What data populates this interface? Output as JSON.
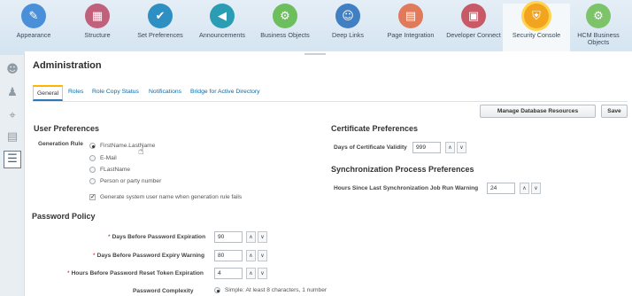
{
  "springboard": {
    "items": [
      {
        "label": "Appearance",
        "icon": "paintbrush-icon",
        "glyph": "✎",
        "color": "#4a90d9"
      },
      {
        "label": "Structure",
        "icon": "grid-icon",
        "glyph": "▦",
        "color": "#c0607a"
      },
      {
        "label": "Set Preferences",
        "icon": "user-check-icon",
        "glyph": "✔",
        "color": "#2e8fc2"
      },
      {
        "label": "Announcements",
        "icon": "megaphone-icon",
        "glyph": "◀",
        "color": "#2a9db5"
      },
      {
        "label": "Business Objects",
        "icon": "gears-icon",
        "glyph": "⚙",
        "color": "#6cbf5c"
      },
      {
        "label": "Deep Links",
        "icon": "people-icon",
        "glyph": "☺",
        "color": "#3f7fc2"
      },
      {
        "label": "Page Integration",
        "icon": "document-icon",
        "glyph": "▤",
        "color": "#e07a5a"
      },
      {
        "label": "Developer Connect",
        "icon": "monitor-icon",
        "glyph": "▣",
        "color": "#c85a68"
      },
      {
        "label": "Security Console",
        "icon": "shield-icon",
        "glyph": "⛨",
        "color": "#f2a41e"
      },
      {
        "label": "HCM Business Objects",
        "label_line1": "HCM Business",
        "label_line2": "Objects",
        "icon": "gears-icon",
        "glyph": "⚙",
        "color": "#7cc36a"
      }
    ]
  },
  "rail": {
    "items": [
      {
        "name": "people-group-icon",
        "glyph": "☻"
      },
      {
        "name": "user-icon",
        "glyph": "♟"
      },
      {
        "name": "user-search-icon",
        "glyph": "⌖"
      },
      {
        "name": "id-card-icon",
        "glyph": "▤"
      },
      {
        "name": "list-icon",
        "glyph": "☰"
      }
    ]
  },
  "page": {
    "title": "Administration",
    "tabs": [
      "General",
      "Roles",
      "Role Copy Status",
      "Notifications",
      "Bridge for Active Directory"
    ],
    "buttons": {
      "manage_db": "Manage Database Resources",
      "save": "Save"
    }
  },
  "user_prefs": {
    "title": "User Preferences",
    "generation_rule_label": "Generation Rule",
    "options": [
      "FirstName.LastName",
      "E-Mail",
      "FLastName",
      "Person or party number"
    ],
    "selected_index": 0,
    "checkbox_label": "Generate system user name when generation rule fails",
    "checkbox_checked": true
  },
  "cert_prefs": {
    "title": "Certificate Preferences",
    "validity_label": "Days of Certificate Validity",
    "validity_value": "999"
  },
  "sync_prefs": {
    "title": "Synchronization Process Preferences",
    "hours_label": "Hours Since Last Synchronization Job Run Warning",
    "hours_value": "24"
  },
  "password_policy": {
    "title": "Password Policy",
    "expiration_label": "Days Before Password Expiration",
    "expiration_value": "90",
    "warning_label": "Days Before Password Expiry Warning",
    "warning_value": "80",
    "reset_label": "Hours Before Password Reset Token Expiration",
    "reset_value": "4",
    "complexity_label": "Password Complexity",
    "complexity_value": "Simple: At least 8 characters, 1 number"
  },
  "icons": {
    "up": "∧",
    "down": "∨",
    "required": "*",
    "check": "✓",
    "cursor": "☝"
  }
}
